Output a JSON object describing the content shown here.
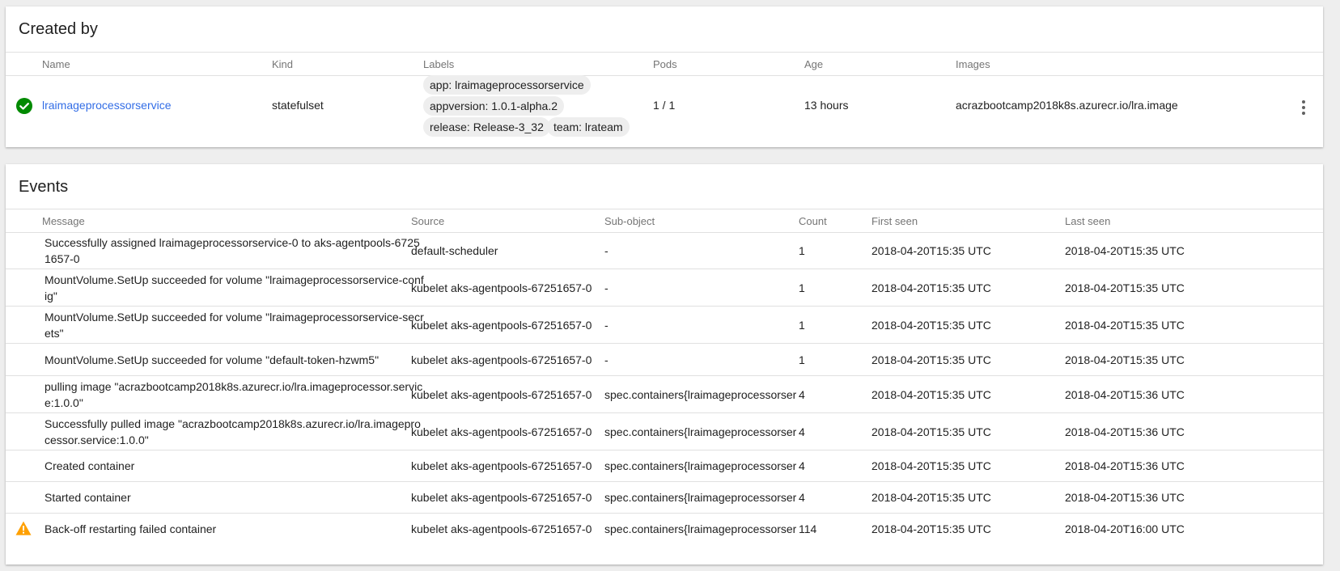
{
  "created_by": {
    "title": "Created by",
    "columns": [
      "Name",
      "Kind",
      "Labels",
      "Pods",
      "Age",
      "Images"
    ],
    "row": {
      "status_icon": "check-circle-icon",
      "name": "lraimageprocessorservice",
      "kind": "statefulset",
      "labels": [
        "app: lraimageprocessorservice",
        "appversion: 1.0.1-alpha.2",
        "release: Release-3_32",
        "team: lrateam"
      ],
      "pods": "1 / 1",
      "age": "13 hours",
      "images": "acrazbootcamp2018k8s.azurecr.io/lra.image",
      "menu_icon": "more-vert-icon"
    }
  },
  "events": {
    "title": "Events",
    "columns": [
      "Message",
      "Source",
      "Sub-object",
      "Count",
      "First seen",
      "Last seen"
    ],
    "rows": [
      {
        "icon": "",
        "message": "Successfully assigned lraimageprocessorservice-0 to aks-agentpools-67251657-0",
        "source": "default-scheduler",
        "subobject": "-",
        "count": "1",
        "first_seen": "2018-04-20T15:35 UTC",
        "last_seen": "2018-04-20T15:35 UTC"
      },
      {
        "icon": "",
        "message": "MountVolume.SetUp succeeded for volume \"lraimageprocessorservice-config\"",
        "source": "kubelet aks-agentpools-67251657-0",
        "subobject": "-",
        "count": "1",
        "first_seen": "2018-04-20T15:35 UTC",
        "last_seen": "2018-04-20T15:35 UTC"
      },
      {
        "icon": "",
        "message": "MountVolume.SetUp succeeded for volume \"lraimageprocessorservice-secrets\"",
        "source": "kubelet aks-agentpools-67251657-0",
        "subobject": "-",
        "count": "1",
        "first_seen": "2018-04-20T15:35 UTC",
        "last_seen": "2018-04-20T15:35 UTC"
      },
      {
        "icon": "",
        "message": "MountVolume.SetUp succeeded for volume \"default-token-hzwm5\"",
        "source": "kubelet aks-agentpools-67251657-0",
        "subobject": "-",
        "count": "1",
        "first_seen": "2018-04-20T15:35 UTC",
        "last_seen": "2018-04-20T15:35 UTC"
      },
      {
        "icon": "",
        "message": "pulling image \"acrazbootcamp2018k8s.azurecr.io/lra.imageprocessor.service:1.0.0\"",
        "source": "kubelet aks-agentpools-67251657-0",
        "subobject": "spec.containers{lraimageprocessorservice}",
        "count": "4",
        "first_seen": "2018-04-20T15:35 UTC",
        "last_seen": "2018-04-20T15:36 UTC"
      },
      {
        "icon": "",
        "message": "Successfully pulled image \"acrazbootcamp2018k8s.azurecr.io/lra.imageprocessor.service:1.0.0\"",
        "source": "kubelet aks-agentpools-67251657-0",
        "subobject": "spec.containers{lraimageprocessorservice}",
        "count": "4",
        "first_seen": "2018-04-20T15:35 UTC",
        "last_seen": "2018-04-20T15:36 UTC"
      },
      {
        "icon": "",
        "message": "Created container",
        "source": "kubelet aks-agentpools-67251657-0",
        "subobject": "spec.containers{lraimageprocessorservice}",
        "count": "4",
        "first_seen": "2018-04-20T15:35 UTC",
        "last_seen": "2018-04-20T15:36 UTC"
      },
      {
        "icon": "",
        "message": "Started container",
        "source": "kubelet aks-agentpools-67251657-0",
        "subobject": "spec.containers{lraimageprocessorservice}",
        "count": "4",
        "first_seen": "2018-04-20T15:35 UTC",
        "last_seen": "2018-04-20T15:36 UTC"
      },
      {
        "icon": "warning-icon",
        "message": "Back-off restarting failed container",
        "source": "kubelet aks-agentpools-67251657-0",
        "subobject": "spec.containers{lraimageprocessorservice}",
        "count": "114",
        "first_seen": "2018-04-20T15:35 UTC",
        "last_seen": "2018-04-20T16:00 UTC"
      }
    ]
  },
  "colors": {
    "link": "#326de6",
    "success": "#008a00",
    "warning": "#ffa000"
  }
}
